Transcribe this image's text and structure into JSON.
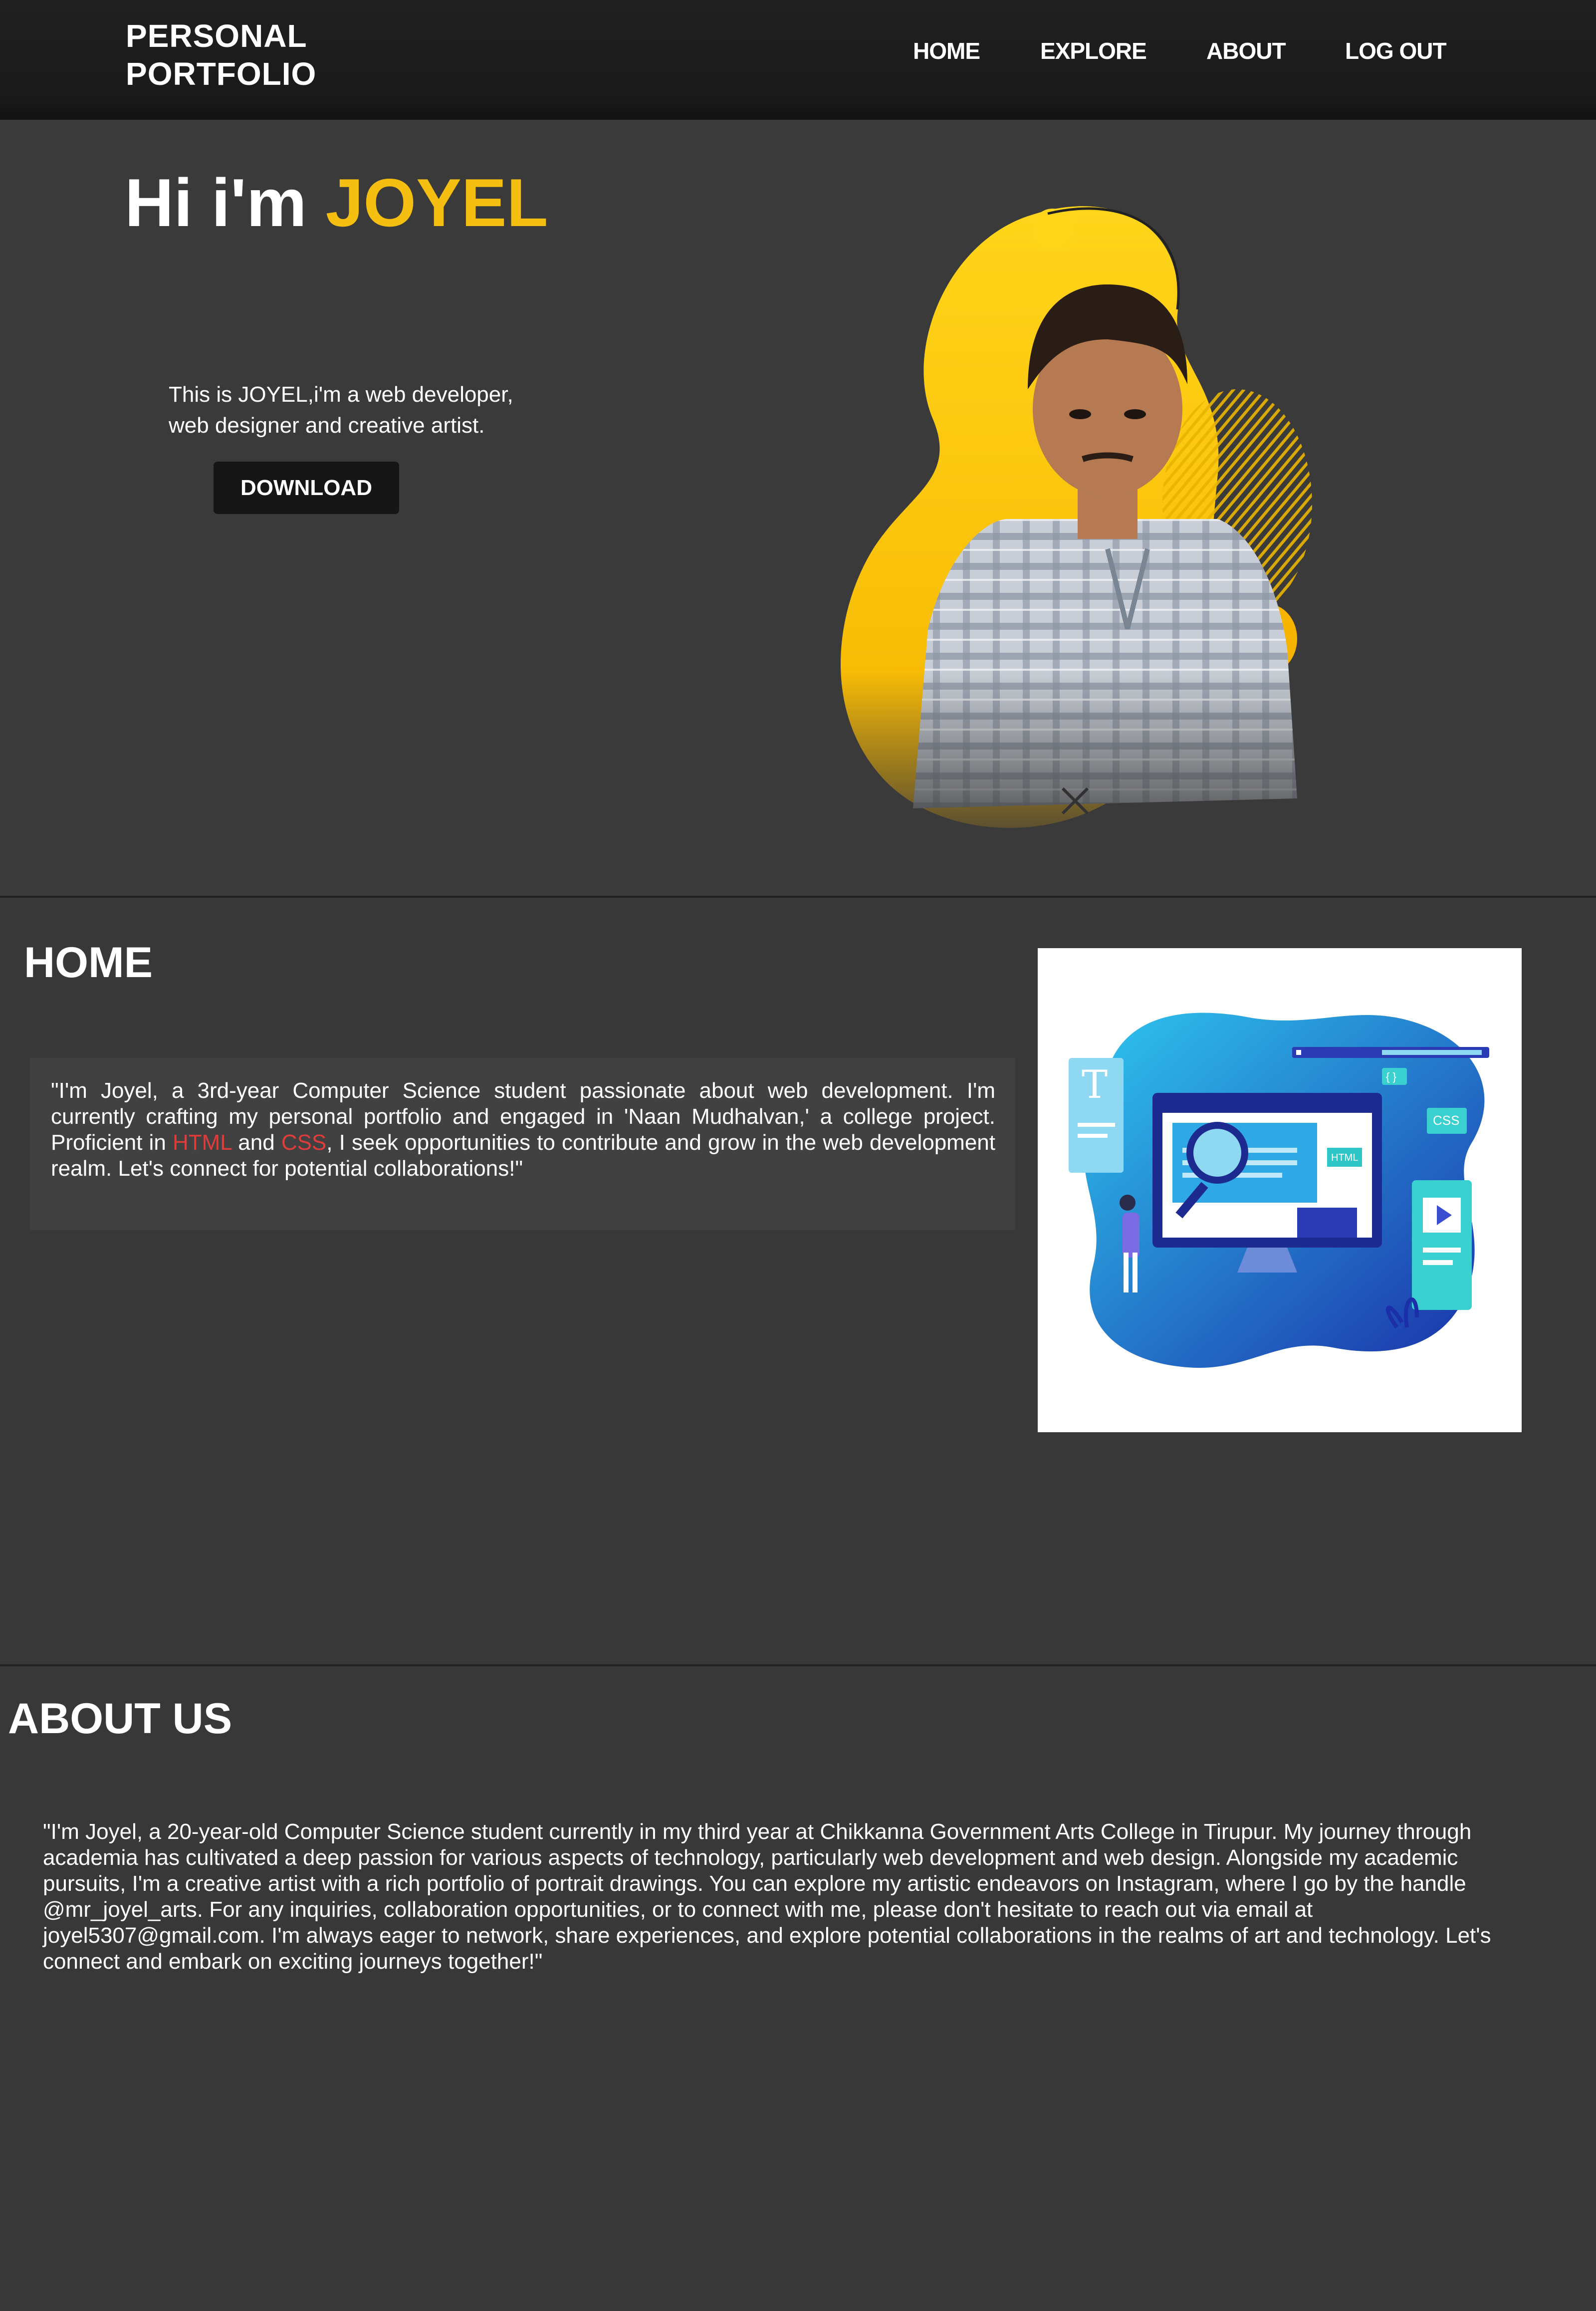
{
  "header": {
    "logo_line1": "PERSONAL",
    "logo_line2": "PORTFOLIO",
    "nav": [
      "HOME",
      "EXPLORE",
      "ABOUT",
      "LOG OUT"
    ]
  },
  "hero": {
    "greeting": "Hi i'm",
    "name": "JOYEL",
    "subtitle_line1": "This is JOYEL,i'm a web developer,",
    "subtitle_line2": "web designer and creative artist.",
    "download_label": "DOWNLOAD"
  },
  "home": {
    "title": "HOME",
    "text_before_html": "\"I'm Joyel, a 3rd-year Computer Science student passionate about web development. I'm currently crafting my personal portfolio and engaged in 'Naan Mudhalvan,' a college project. Proficient in ",
    "html_word": "HTML",
    "and_word": " and ",
    "css_word": "CSS",
    "text_after_css": ", I seek opportunities to contribute and grow in the web development realm. Let's connect for potential collaborations!\"",
    "illustration_labels": {
      "t": "T",
      "html": "HTML",
      "css": "CSS",
      "code": "{ }"
    }
  },
  "about": {
    "title": "ABOUT US",
    "text": "\"I'm Joyel, a 20-year-old Computer Science student currently in my third year at Chikkanna Government Arts College in Tirupur. My journey through academia has cultivated a deep passion for various aspects of technology, particularly web development and web design. Alongside my academic pursuits, I'm a creative artist with a rich portfolio of portrait drawings. You can explore my artistic endeavors on Instagram, where I go by the handle @mr_joyel_arts. For any inquiries, collaboration opportunities, or to connect with me, please don't hesitate to reach out via email at joyel5307@gmail.com. I'm always eager to network, share experiences, and explore potential collaborations in the realms of art and technology. Let's connect and embark on exciting journeys together!\""
  },
  "colors": {
    "accent": "#f4bf11",
    "highlight": "#e03c3c",
    "background": "#383838",
    "header": "#1c1c1c"
  }
}
